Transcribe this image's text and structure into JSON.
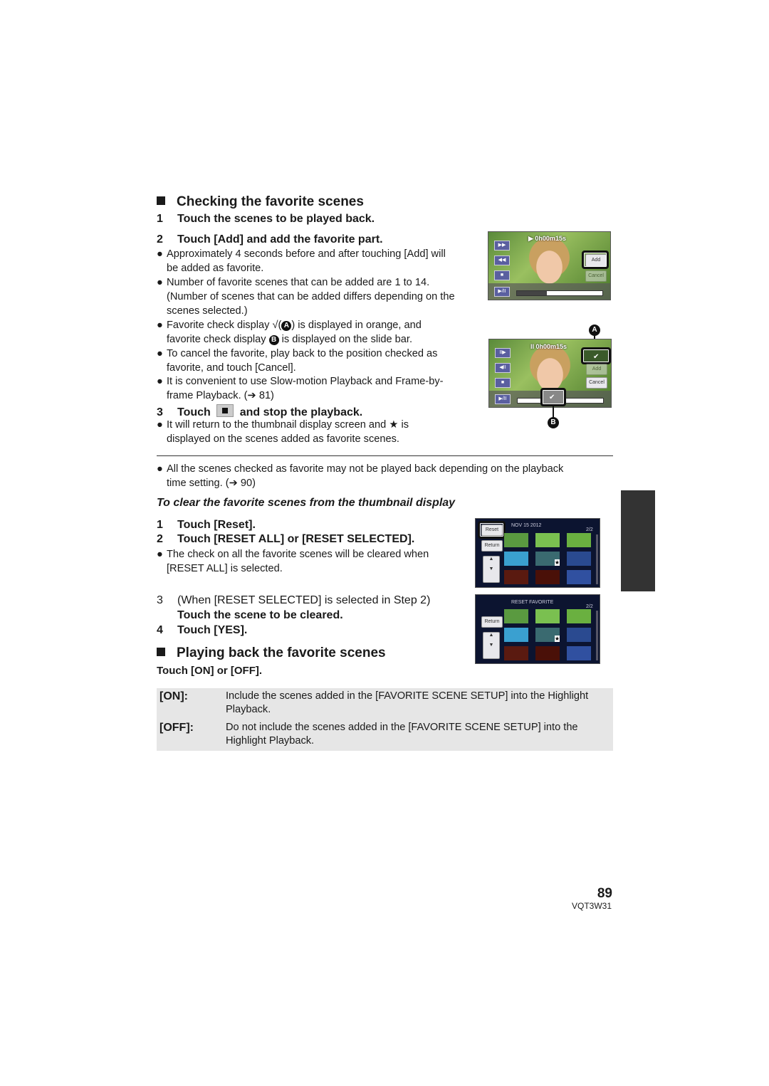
{
  "section1": {
    "heading": "Checking the favorite scenes",
    "steps": [
      {
        "num": "1",
        "text": "Touch the scenes to be played back."
      },
      {
        "num": "2",
        "text": "Touch [Add] and add the favorite part."
      },
      {
        "num": "3",
        "text_before": "Touch",
        "text_after": "and stop the playback."
      }
    ],
    "bullets": [
      [
        "Approximately 4 seconds before and after touching [Add] will",
        "be added as favorite."
      ],
      [
        "Number of favorite scenes that can be added are 1 to 14.",
        "(Number of scenes that can be added differs depending on the",
        "scenes selected.)"
      ],
      [
        "To cancel the favorite, play back to the position checked as",
        "favorite, and touch [Cancel]."
      ],
      [
        "It is convenient to use Slow-motion Playback and Frame-by-",
        "frame Playback. (➔ 81)"
      ]
    ],
    "check_bullet": {
      "part1": "Favorite check display",
      "part2": "(",
      "part3": ") is displayed in orange, and",
      "line2a": "favorite check display",
      "line2b": "is displayed on the slide bar."
    },
    "step3_bullet": {
      "part1": "It will return to the thumbnail display screen and",
      "part2": "is",
      "line2": "displayed on the scenes added as favorite scenes."
    }
  },
  "callouts": {
    "a": "A",
    "b": "B"
  },
  "screen1": {
    "time": "0h00m15s",
    "add": "Add",
    "cancel": "Cancel",
    "progress": 0.35
  },
  "screen2": {
    "time": "0h00m15s",
    "add": "Add",
    "cancel": "Cancel"
  },
  "note": [
    "All the scenes checked as favorite may not be played back depending on the playback",
    "time setting. (➔ 90)"
  ],
  "clear": {
    "heading": "To clear the favorite scenes from the thumbnail display",
    "steps": [
      {
        "num": "1",
        "text": "Touch [Reset]."
      },
      {
        "num": "2",
        "text": "Touch [RESET ALL] or [RESET SELECTED]."
      },
      {
        "num": "3",
        "text": "(When [RESET SELECTED] is selected in Step 2)",
        "text2": "Touch the scene to be cleared."
      },
      {
        "num": "4",
        "text": "Touch [YES]."
      }
    ],
    "bullet": [
      "The check on all the favorite scenes will be cleared when",
      "[RESET ALL] is selected."
    ]
  },
  "thumb1": {
    "reset": "Reset",
    "return": "Return",
    "date": "NOV 15 2012",
    "page": "2/2"
  },
  "thumb2": {
    "title": "RESET FAVORITE",
    "return": "Return",
    "page": "2/2"
  },
  "section2": {
    "heading": "Playing back the favorite scenes",
    "sub": "Touch [ON] or [OFF].",
    "options": [
      {
        "key": "[ON]:",
        "desc": [
          "Include the scenes added in the [FAVORITE SCENE SETUP] into the Highlight",
          "Playback."
        ]
      },
      {
        "key": "[OFF]:",
        "desc": [
          "Do not include the scenes added in the [FAVORITE SCENE SETUP] into the",
          "Highlight Playback."
        ]
      }
    ]
  },
  "footer": {
    "page": "89",
    "code": "VQT3W31"
  }
}
